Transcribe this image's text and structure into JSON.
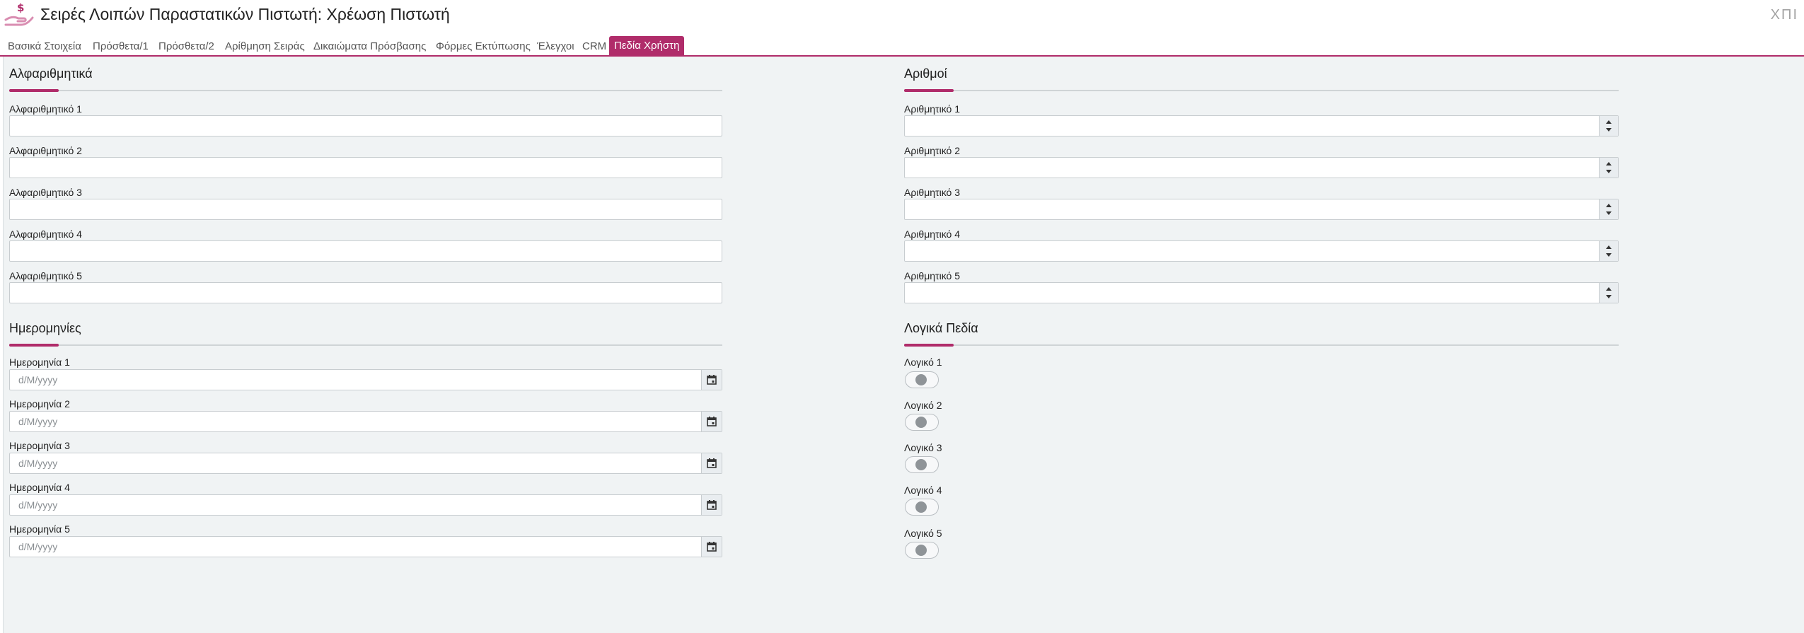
{
  "header": {
    "title": "Σειρές Λοιπών Παραστατικών Πιστωτή: Χρέωση Πιστωτή",
    "user_code": "ΧΠΙ",
    "logo_icon": "hand-money-icon",
    "accent_color": "#b02c6a"
  },
  "tabs": [
    {
      "label": "Βασικά Στοιχεία",
      "active": false
    },
    {
      "label": "Πρόσθετα/1",
      "active": false
    },
    {
      "label": "Πρόσθετα/2",
      "active": false
    },
    {
      "label": "Αρίθμηση Σειράς",
      "active": false
    },
    {
      "label": "Δικαιώματα Πρόσβασης",
      "active": false
    },
    {
      "label": "Φόρμες Εκτύπωσης",
      "active": false
    },
    {
      "label": "Έλεγχοι",
      "active": false
    },
    {
      "label": "CRM",
      "active": false
    },
    {
      "label": "Πεδία Χρήστη",
      "active": true
    }
  ],
  "alphanumeric": {
    "title": "Αλφαριθμητικά",
    "fields": [
      {
        "label": "Αλφαριθμητικό 1",
        "value": ""
      },
      {
        "label": "Αλφαριθμητικό 2",
        "value": ""
      },
      {
        "label": "Αλφαριθμητικό 3",
        "value": ""
      },
      {
        "label": "Αλφαριθμητικό 4",
        "value": ""
      },
      {
        "label": "Αλφαριθμητικό 5",
        "value": ""
      }
    ]
  },
  "numbers": {
    "title": "Αριθμοί",
    "fields": [
      {
        "label": "Αριθμητικό 1",
        "value": ""
      },
      {
        "label": "Αριθμητικό 2",
        "value": ""
      },
      {
        "label": "Αριθμητικό 3",
        "value": ""
      },
      {
        "label": "Αριθμητικό 4",
        "value": ""
      },
      {
        "label": "Αριθμητικό 5",
        "value": ""
      }
    ]
  },
  "dates": {
    "title": "Ημερομηνίες",
    "fields": [
      {
        "label": "Ημερομηνία 1",
        "placeholder": "d/M/yyyy"
      },
      {
        "label": "Ημερομηνία 2",
        "placeholder": "d/M/yyyy"
      },
      {
        "label": "Ημερομηνία 3",
        "placeholder": "d/M/yyyy"
      },
      {
        "label": "Ημερομηνία 4",
        "placeholder": "d/M/yyyy"
      },
      {
        "label": "Ημερομηνία 5",
        "placeholder": "d/M/yyyy"
      }
    ]
  },
  "logicals": {
    "title": "Λογικά Πεδία",
    "fields": [
      {
        "label": "Λογικό 1",
        "state": "indeterminate"
      },
      {
        "label": "Λογικό 2",
        "state": "indeterminate"
      },
      {
        "label": "Λογικό 3",
        "state": "indeterminate"
      },
      {
        "label": "Λογικό 4",
        "state": "indeterminate"
      },
      {
        "label": "Λογικό 5",
        "state": "indeterminate"
      }
    ]
  }
}
